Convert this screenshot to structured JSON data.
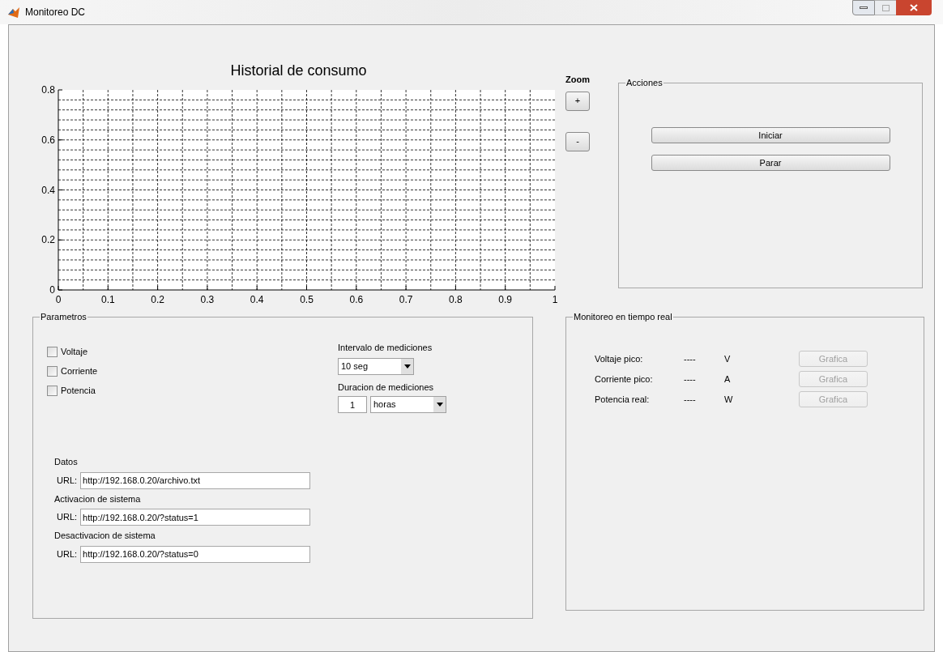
{
  "window": {
    "title": "Monitoreo DC"
  },
  "chart": {
    "chart_data": {
      "type": "line",
      "title": "Historial de consumo",
      "xlim": [
        0,
        1
      ],
      "ylim": [
        0,
        0.8
      ],
      "xticks": [
        0,
        0.1,
        0.2,
        0.3,
        0.4,
        0.5,
        0.6,
        0.7,
        0.8,
        0.9,
        {
          "value": 1,
          "label": "1"
        }
      ],
      "yticks": [
        0,
        0.2,
        0.4,
        0.6,
        0.8
      ],
      "grid": true
    }
  },
  "zoom": {
    "label": "Zoom",
    "buttons": [
      "+",
      "-"
    ]
  },
  "acciones": {
    "title": "Acciones",
    "buttons": [
      "Iniciar",
      "Parar"
    ]
  },
  "parametros": {
    "title": "Parametros",
    "checkboxes": [
      {
        "label": "Voltaje",
        "checked": false
      },
      {
        "label": "Corriente",
        "checked": false
      },
      {
        "label": "Potencia",
        "checked": false
      }
    ],
    "intervalo": {
      "label": "Intervalo de mediciones",
      "value": "10 seg"
    },
    "duracion": {
      "label": "Duracion de mediciones",
      "amount": "1",
      "unit": "horas"
    },
    "urls": [
      {
        "heading": "Datos",
        "label": "URL:",
        "value": "http://192.168.0.20/archivo.txt"
      },
      {
        "heading": "Activacion de sistema",
        "label": "URL:",
        "value": "http://192.168.0.20/?status=1"
      },
      {
        "heading": "Desactivacion de sistema",
        "label": "URL:",
        "value": "http://192.168.0.20/?status=0"
      }
    ]
  },
  "monitoreo": {
    "title": "Monitoreo en tiempo real",
    "rows": [
      {
        "label": "Voltaje pico:",
        "value": "----",
        "unit": "V",
        "button": "Grafica",
        "disabled": true
      },
      {
        "label": "Corriente pico:",
        "value": "----",
        "unit": "A",
        "button": "Grafica",
        "disabled": true
      },
      {
        "label": "Potencia real:",
        "value": "----",
        "unit": "W",
        "button": "Grafica",
        "disabled": true
      }
    ]
  }
}
